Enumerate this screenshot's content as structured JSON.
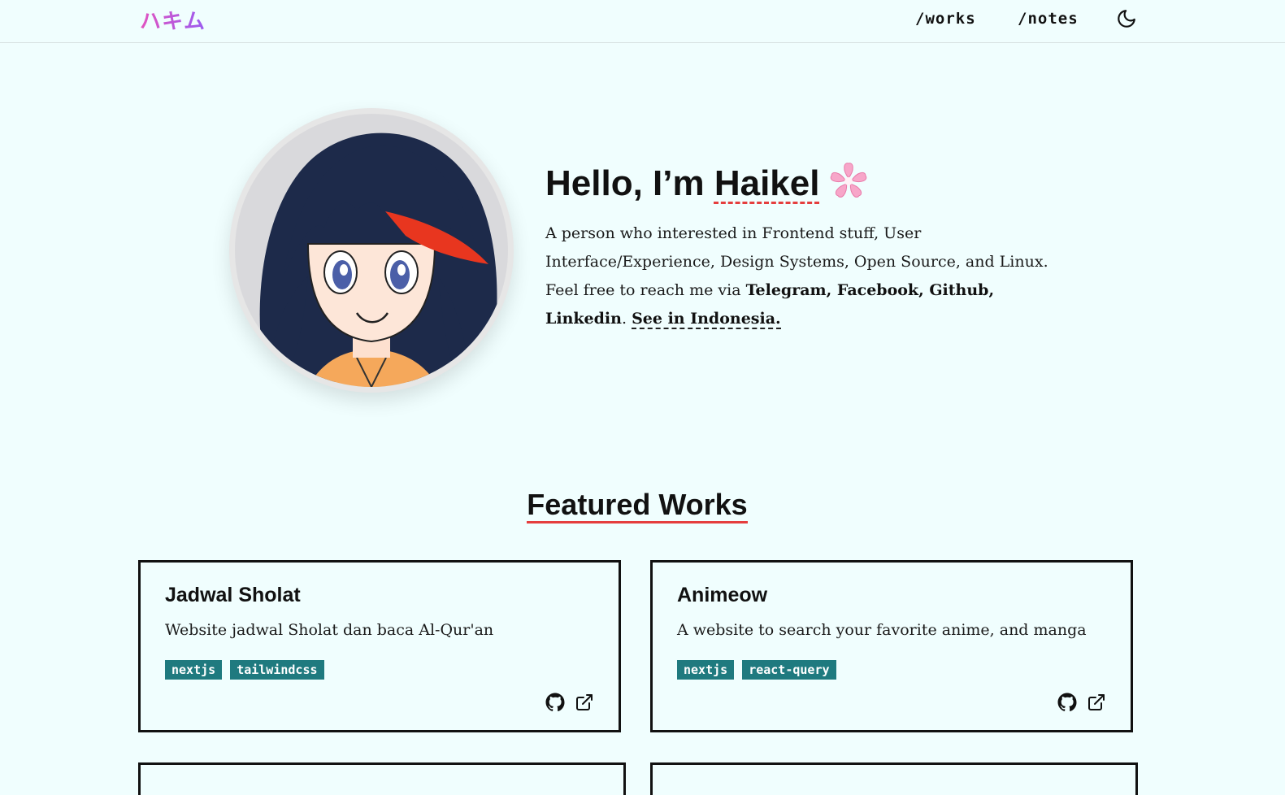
{
  "header": {
    "logo": "ハキム",
    "nav": [
      {
        "label": "/works"
      },
      {
        "label": "/notes"
      }
    ],
    "theme_icon": "moon-icon"
  },
  "hero": {
    "greeting": "Hello, I’m ",
    "name": "Haikel",
    "flower_icon": "cherry-blossom-icon",
    "desc_1": "A person who interested in Frontend stuff, User Interface/Experience, Design Systems, Open Source, and Linux. Feel free to reach me via ",
    "links": {
      "telegram": "Telegram",
      "facebook": "Facebook",
      "github": "Github",
      "linkedin": "Linkedin"
    },
    "sep": ", ",
    "period": ". ",
    "see_link": "See in Indonesia."
  },
  "featured": {
    "title": "Featured Works",
    "cards": [
      {
        "title": "Jadwal Sholat",
        "description": "Website jadwal Sholat dan baca Al-Qur'an",
        "tags": [
          "nextjs",
          "tailwindcss"
        ]
      },
      {
        "title": "Animeow",
        "description": "A website to search your favorite anime, and manga",
        "tags": [
          "nextjs",
          "react-query"
        ]
      }
    ]
  },
  "colors": {
    "background": "#f0fefe",
    "accent_red": "#e53e3e",
    "tag_bg": "#1f7a7f",
    "logo_gradient": [
      "#e254c0",
      "#9a5cf0"
    ]
  }
}
